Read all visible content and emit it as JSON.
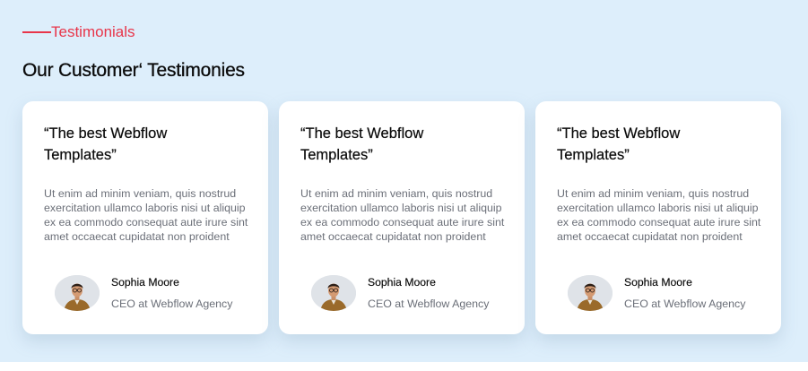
{
  "section": {
    "eyebrow": "Testimonials",
    "heading": "Our Customer‘ Testimonies"
  },
  "testimonials": [
    {
      "quote": "“The best Webflow Templates”",
      "body": "Ut enim ad minim veniam, quis nostrud exercitation ullamco laboris nisi ut aliquip ex ea commodo consequat aute irure sint amet occaecat cupidatat non proident",
      "author_name": "Sophia Moore",
      "author_role": "CEO at Webflow Agency"
    },
    {
      "quote": "“The best Webflow Templates”",
      "body": "Ut enim ad minim veniam, quis nostrud exercitation ullamco laboris nisi ut aliquip ex ea commodo consequat aute irure sint amet occaecat cupidatat non proident",
      "author_name": "Sophia Moore",
      "author_role": "CEO at Webflow Agency"
    },
    {
      "quote": "“The best Webflow Templates”",
      "body": "Ut enim ad minim veniam, quis nostrud exercitation ullamco laboris nisi ut aliquip ex ea commodo consequat aute irure sint amet occaecat cupidatat non proident",
      "author_name": "Sophia Moore",
      "author_role": "CEO at Webflow Agency"
    }
  ],
  "colors": {
    "background": "#ddeefb",
    "accent": "#e8354a",
    "card": "#ffffff",
    "muted_text": "#6b6f78"
  },
  "icons": {
    "avatar": "user-photo-avatar"
  }
}
